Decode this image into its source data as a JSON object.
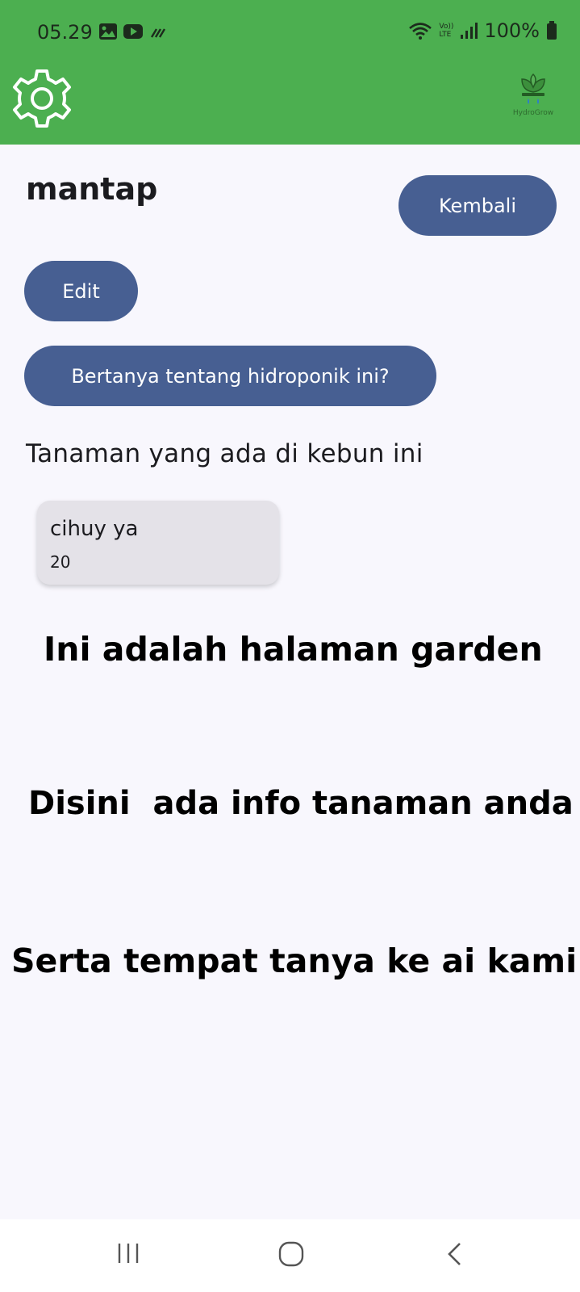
{
  "status_bar": {
    "time": "05.29",
    "battery": "100%",
    "network": "LTE",
    "volte": "Vo))"
  },
  "app_bar": {
    "settings_icon": "gear-icon",
    "logo_text": "HydroGrow",
    "color": "#4caf50"
  },
  "garden": {
    "name": "mantap",
    "back_label": "Kembali",
    "edit_label": "Edit",
    "ask_label": "Bertanya tentang hidroponik ini?",
    "plants_heading": "Tanaman yang ada di kebun ini",
    "plants": [
      {
        "name": "cihuy ya",
        "quantity": "20"
      }
    ]
  },
  "captions": {
    "line1": "Ini adalah halaman garden",
    "line2": "Disini  ada info tanaman anda",
    "line3": "Serta tempat tanya ke ai kami"
  },
  "nav_bar": {
    "recents": "recents-icon",
    "home": "home-icon",
    "back": "back-icon"
  },
  "colors": {
    "primary_button": "#475f92",
    "background": "#f8f7fd",
    "card": "#e4e2e8"
  }
}
